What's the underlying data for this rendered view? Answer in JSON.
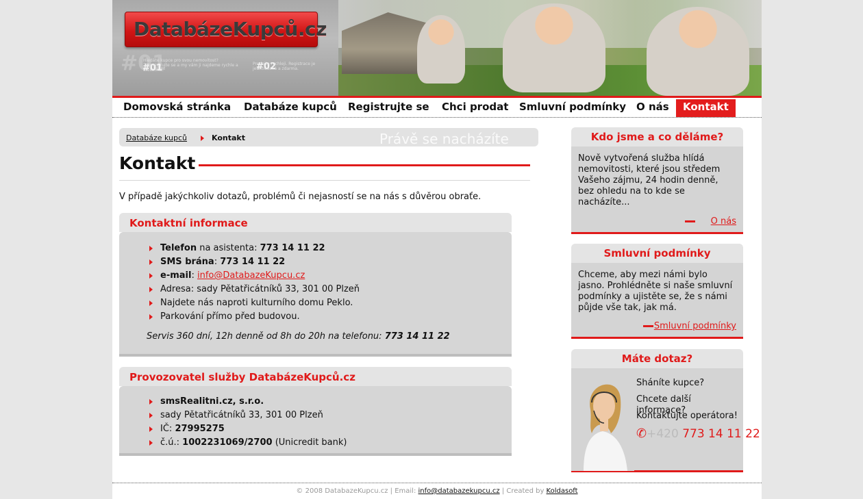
{
  "header": {
    "logo_text": "DatabázeKupců.cz",
    "step1": "#01",
    "step2": "#02",
    "bg_number": "#01",
    "scribble1": "Hledáte kupce pro svou nemovitost? Zaregistrujte se a my vám ji najdeme rychle a efektivně.",
    "scribble2": "Prodejte rychleji. Registrace je jednoduchá a zdarma."
  },
  "nav": {
    "items": [
      {
        "label": "Domovská stránka"
      },
      {
        "label": "Databáze kupců"
      },
      {
        "label": "Registrujte se"
      },
      {
        "label": "Chci prodat"
      },
      {
        "label": "Smluvní podmínky"
      },
      {
        "label": "O nás"
      },
      {
        "label": "Kontakt"
      }
    ]
  },
  "breadcrumb": {
    "root": "Databáze kupců",
    "current": "Kontakt",
    "ghost": "Právě se nacházíte"
  },
  "main": {
    "title": "Kontakt",
    "intro": "V případě jakýchkoliv dotazů, problémů či nejasností se na nás s důvěrou obraťe."
  },
  "contact": {
    "heading": "Kontaktní informace",
    "phone_label": "Telefon",
    "phone_mid": " na asistenta: ",
    "phone_value": "773 14 11 22",
    "sms_label": "SMS brána",
    "sms_mid": ": ",
    "sms_value": "773 14 11 22",
    "email_label": "e-mail",
    "email_mid": ": ",
    "email_value": "info@DatabazeKupcu.cz",
    "address": "Adresa: sady Pětatřicátníků 33, 301 00 Plzeň",
    "find": "Najdete nás naproti kulturního domu Peklo.",
    "parking": "Parkování přímo před budovou.",
    "servis_text": "Servis 360 dní, 12h denně od 8h do 20h na telefonu: ",
    "servis_phone": "773 14 11 22"
  },
  "operator": {
    "heading": "Provozovatel služby DatabázeKupců.cz",
    "company": "smsRealitni.cz, s.r.o.",
    "address": "sady Pětatřicátníků 33, 301 00 Plzeň",
    "ic_label": "IČ: ",
    "ic_value": "27995275",
    "cu_label": "č.ú.: ",
    "cu_value": "1002231069/2700",
    "cu_bank": " (Unicredit bank)"
  },
  "sidebar": {
    "about": {
      "heading": "Kdo jsme a co děláme?",
      "text": "Nově vytvořená služba hlídá nemovitosti, které jsou středem Vašeho zájmu, 24 hodin denně, bez ohledu na to kde se nacházíte...",
      "link": "O nás"
    },
    "terms": {
      "heading": "Smluvní podmínky",
      "text": "Chceme, aby mezi námi bylo jasno. Prohlédněte si naše smluvní podmínky a ujistěte se, že s námi půjde vše tak, jak má.",
      "link": "Smluvní podmínky"
    },
    "question": {
      "heading": "Máte dotaz?",
      "q1": "Sháníte kupce?",
      "q2": "Chcete další informace?",
      "q3": "Kontaktujte operátora!",
      "phone_prefix": "+420 ",
      "phone_number": "773 14 11 22"
    }
  },
  "footer": {
    "copy": "© 2008 DatabazeKupcu.cz | Email: ",
    "email": "info@databazekupcu.cz",
    "created": " | Created by ",
    "author": "Koldasoft"
  }
}
